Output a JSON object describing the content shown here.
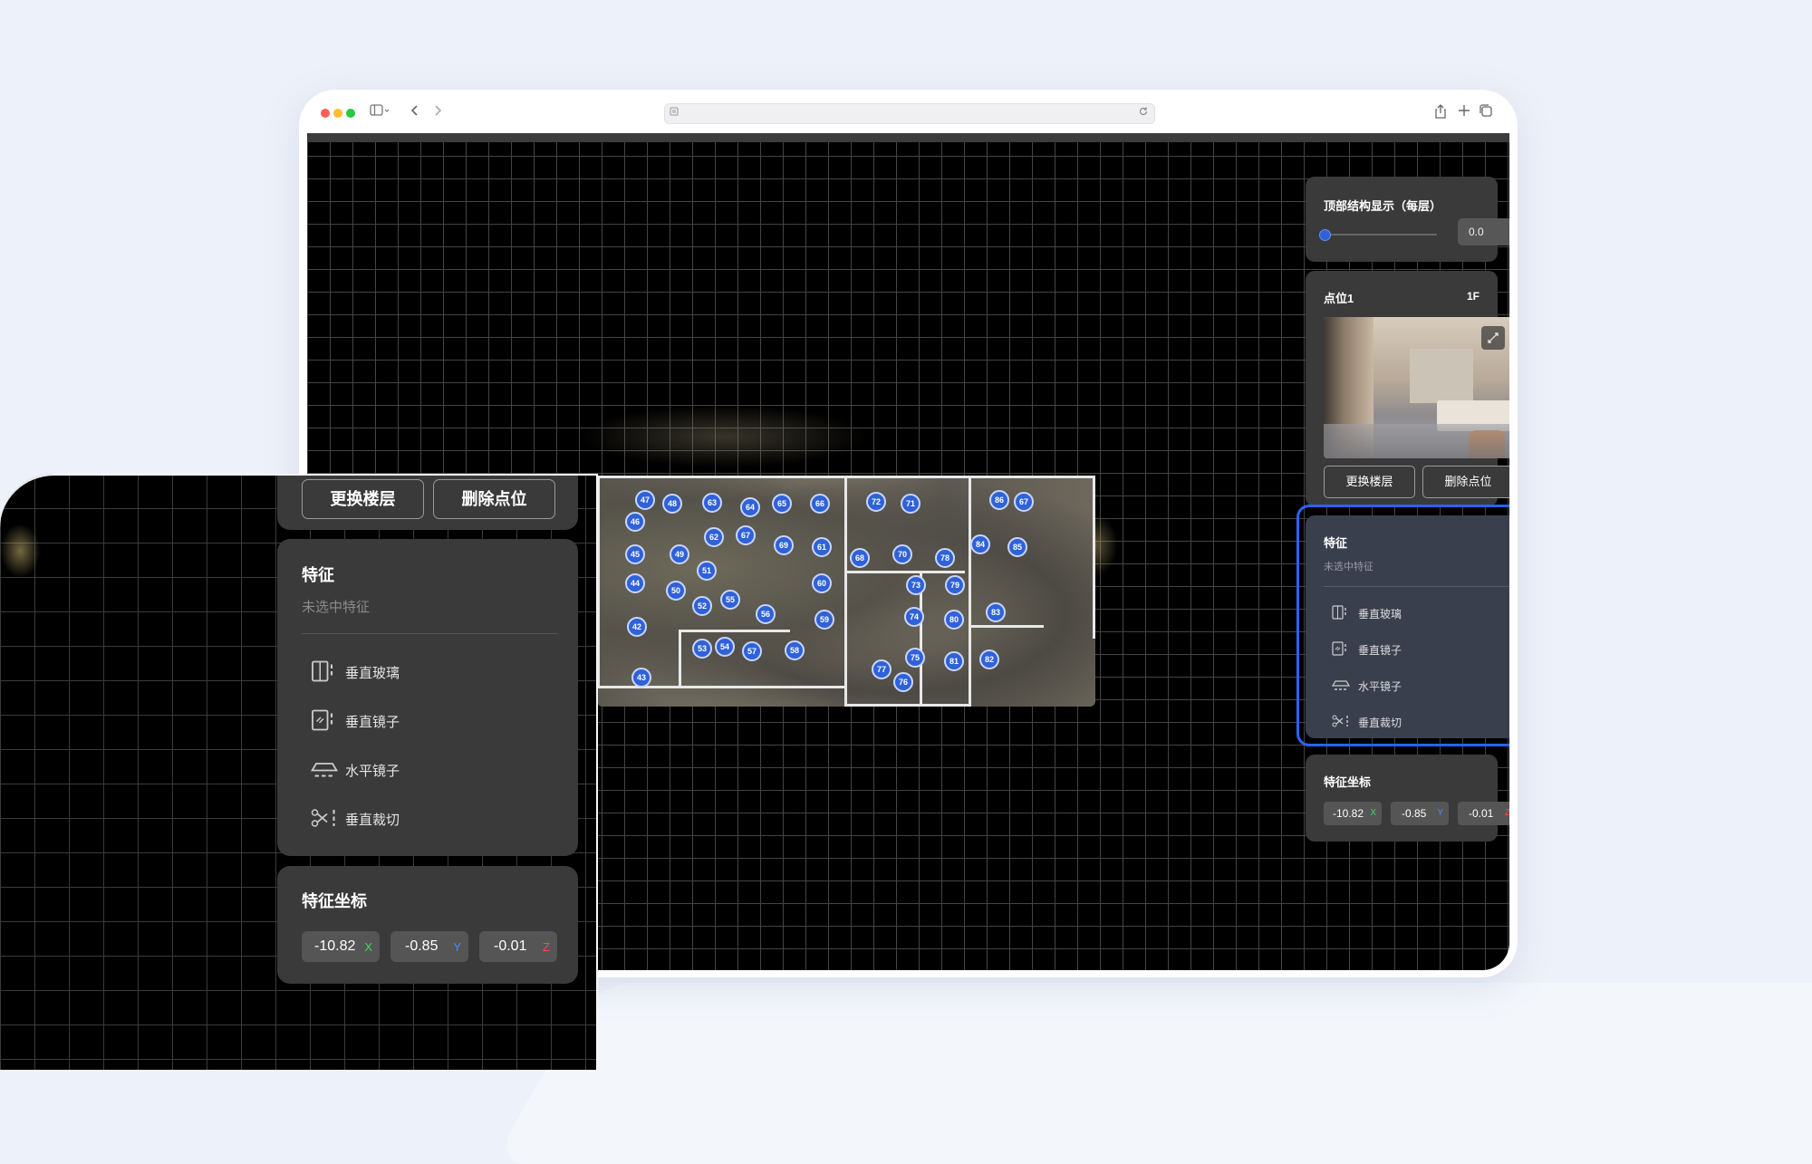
{
  "top_structure": {
    "title": "顶部结构显示（每层）",
    "slider_level": 0.0,
    "value": "0.0"
  },
  "point": {
    "name": "点位1",
    "floor": "1F",
    "change_floor_label": "更换楼层",
    "delete_point_label": "删除点位"
  },
  "features": {
    "title": "特征",
    "status": "未选中特征",
    "items": [
      {
        "label": "垂直玻璃",
        "icon": "vertical-glass-icon"
      },
      {
        "label": "垂直镜子",
        "icon": "vertical-mirror-icon"
      },
      {
        "label": "水平镜子",
        "icon": "horizontal-mirror-icon"
      },
      {
        "label": "垂直裁切",
        "icon": "vertical-cut-icon"
      }
    ]
  },
  "coords": {
    "title": "特征坐标",
    "x": "-10.82",
    "x_axis": "X",
    "y": "-0.85",
    "y_axis": "Y",
    "z": "-0.01",
    "z_axis": "Z"
  },
  "markers": [
    "47",
    "48",
    "63",
    "64",
    "65",
    "66",
    "72",
    "71",
    "67",
    "86",
    "46",
    "62",
    "67",
    "61",
    "68",
    "70",
    "78",
    "84",
    "85",
    "45",
    "49",
    "51",
    "69",
    "44",
    "50",
    "55",
    "60",
    "73",
    "79",
    "56",
    "52",
    "59",
    "74",
    "80",
    "83",
    "42",
    "53",
    "54",
    "57",
    "58",
    "75",
    "77",
    "76",
    "81",
    "82",
    "43"
  ],
  "colors": {
    "accent": "#2f62d8",
    "selection": "#2a62ff",
    "panel": "#3a3a3a"
  }
}
